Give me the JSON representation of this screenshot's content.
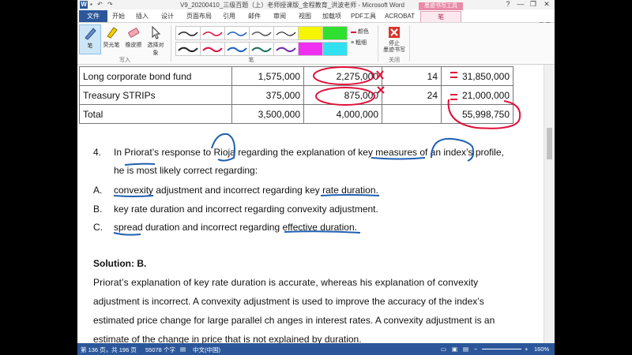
{
  "window": {
    "title": "V9_20200410_三级百题（上）老师授课版_金程教育_洪波老师 - Microsoft Word",
    "help": "?",
    "minimize": "—",
    "restore": "❐",
    "close": "✕",
    "login": "登录"
  },
  "ribbon": {
    "contextual_group": "墨迹书写工具",
    "tabs": [
      "文件",
      "开始",
      "插入",
      "设计",
      "页面布局",
      "引用",
      "邮件",
      "审阅",
      "视图",
      "加载项",
      "PDF工具",
      "ACROBAT",
      "笔"
    ],
    "buttons": {
      "pen": "笔",
      "highlighter": "荧光笔",
      "eraser": "橡皮擦",
      "select": "选择对象",
      "color": "颜色",
      "thickness": "粗细",
      "stop_ink": "停止\n墨迹书写"
    },
    "groups": {
      "write": "写入",
      "pens": "笔",
      "close": "关闭"
    }
  },
  "table": {
    "rows": [
      {
        "name": "Long corporate bond fund",
        "c2": "1,575,000",
        "c3": "2,275,000",
        "c4": "14",
        "c5": "31,850,000"
      },
      {
        "name": "Treasury STRIPs",
        "c2": "375,000",
        "c3": "875,000",
        "c4": "24",
        "c5": "21,000,000"
      },
      {
        "name": "Total",
        "c2": "3,500,000",
        "c3": "4,000,000",
        "c4": "",
        "c5": "55,998,750"
      }
    ]
  },
  "question": {
    "number": "4.",
    "line1": "In Priorat’s response to Rioja regarding the explanation of key measures of an index’s profile,",
    "line2": "he is most likely correct regarding:",
    "options": [
      {
        "letter": "A.",
        "text": "convexity adjustment and incorrect regarding key rate duration."
      },
      {
        "letter": "B.",
        "text": "key rate duration and incorrect regarding convexity adjustment."
      },
      {
        "letter": "C.",
        "text": "spread duration and incorrect regarding effective duration."
      }
    ]
  },
  "solution": {
    "heading": "Solution: B.",
    "lines": [
      "Priorat’s  explanation  of  key  rate  duration  is  accurate,  whereas  his  explanation  of  convexity",
      "adjustment is incorrect. A convexity adjustment is used to improve the accuracy of the index’s",
      "estimated price change for large parallel ch anges in interest rates. A convexity adjustment is an",
      "estimate of the change in price that is not explained by duration."
    ]
  },
  "statusbar": {
    "page": "第 136 页，共 196 页",
    "words": "55078 个字",
    "language": "中文(中国)",
    "zoom": "160%"
  },
  "colors": {
    "word_blue": "#2b579a",
    "ink_red": "#e0103a",
    "ink_blue": "#1f5fb0"
  }
}
